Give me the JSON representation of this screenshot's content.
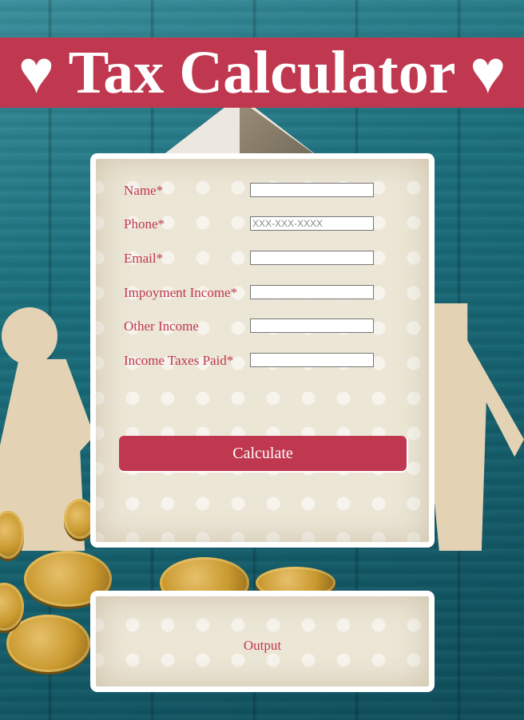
{
  "header": {
    "title": "♥ Tax Calculator ♥"
  },
  "form": {
    "fields": [
      {
        "label": "Name*",
        "value": "",
        "placeholder": ""
      },
      {
        "label": "Phone*",
        "value": "",
        "placeholder": "XXX-XXX-XXXX"
      },
      {
        "label": "Email*",
        "value": "",
        "placeholder": ""
      },
      {
        "label": "Impoyment Income*",
        "value": "",
        "placeholder": ""
      },
      {
        "label": "Other Income",
        "value": "",
        "placeholder": ""
      },
      {
        "label": "Income Taxes Paid*",
        "value": "",
        "placeholder": ""
      }
    ],
    "calculate_label": "Calculate"
  },
  "output": {
    "text": "Output"
  },
  "colors": {
    "accent": "#c0384f",
    "panel_bg": "#ece6d6",
    "background": "#1c6f7c"
  }
}
